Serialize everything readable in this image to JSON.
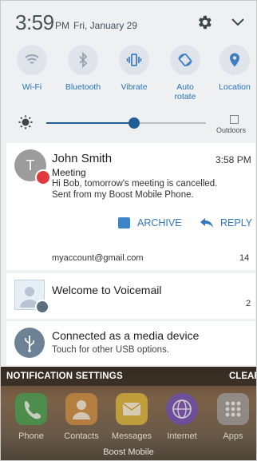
{
  "status": {
    "time": "3:59",
    "ampm": "PM",
    "date": "Fri, January 29"
  },
  "quick_settings": [
    {
      "label": "Wi-Fi",
      "icon": "wifi-icon"
    },
    {
      "label": "Bluetooth",
      "icon": "bluetooth-icon"
    },
    {
      "label": "Vibrate",
      "icon": "vibrate-icon"
    },
    {
      "label": "Auto\nrotate",
      "icon": "auto-rotate-icon"
    },
    {
      "label": "Location",
      "icon": "location-icon"
    }
  ],
  "brightness": {
    "level": 0.55,
    "outdoors_label": "Outdoors"
  },
  "notifications": {
    "email": {
      "avatar_letter": "T",
      "sender": "John Smith",
      "time": "3:58 PM",
      "subject": "Meeting",
      "body": "Hi Bob,  tomorrow's meeting is cancelled.\nSent from my Boost Mobile Phone.",
      "archive_label": "ARCHIVE",
      "reply_label": "REPLY",
      "account": "myaccount@gmail.com",
      "count": "14"
    },
    "voicemail": {
      "title": "Welcome to Voicemail",
      "count": "2"
    },
    "usb": {
      "title": "Connected as a media device",
      "subtitle": "Touch for other USB options."
    }
  },
  "footer": {
    "notification_settings": "NOTIFICATION SETTINGS",
    "clear": "CLEAR"
  },
  "home_apps": [
    {
      "label": "Phone",
      "color": "#3f9c4e"
    },
    {
      "label": "Contacts",
      "color": "#c98a3f"
    },
    {
      "label": "Messages",
      "color": "#d8b339"
    },
    {
      "label": "Internet",
      "color": "#6b4bb8"
    },
    {
      "label": "Apps",
      "color": "#9a9a9a"
    }
  ],
  "carrier": "Boost Mobile",
  "colors": {
    "accent": "#2f79bc",
    "slider": "#1f5f96"
  }
}
